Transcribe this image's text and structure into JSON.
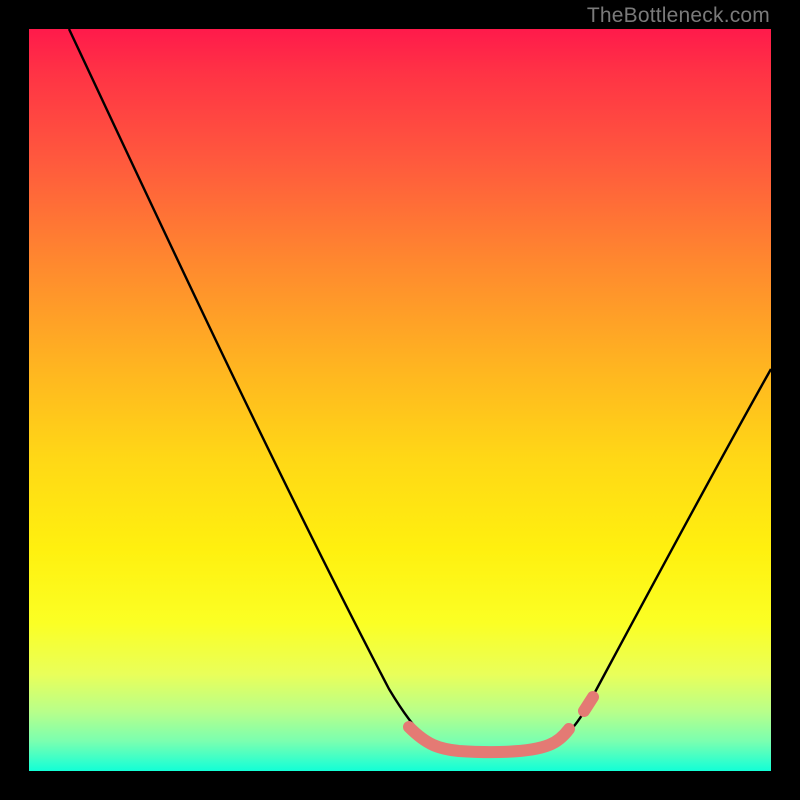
{
  "watermark": {
    "text": "TheBottleneck.com"
  },
  "chart_data": {
    "type": "line",
    "title": "",
    "xlabel": "",
    "ylabel": "",
    "xlim": [
      0,
      100
    ],
    "ylim": [
      0,
      100
    ],
    "grid": false,
    "legend_position": "none",
    "note": "V-shaped bottleneck curve over a red→yellow→green vertical gradient. X is normalized horizontal position (0–100) and Y is normalized 'bottleneck' value (0 near bottom/green = good, 100 at top/red = bad). Values estimated from pixel positions.",
    "series": [
      {
        "name": "bottleneck-curve",
        "x": [
          0,
          5,
          10,
          15,
          20,
          25,
          30,
          35,
          40,
          45,
          50,
          52,
          55,
          58,
          60,
          63,
          65,
          68,
          70,
          72,
          75,
          78,
          80,
          85,
          90,
          95,
          100
        ],
        "y": [
          98,
          90,
          82,
          74,
          66,
          58,
          50,
          42,
          34,
          25,
          15,
          10,
          6,
          4,
          3,
          3,
          3,
          3.5,
          4,
          5,
          8,
          13,
          18,
          27,
          36,
          45,
          54
        ]
      },
      {
        "name": "highlighted-segments",
        "segments": [
          {
            "x_start": 52,
            "x_end": 70,
            "description": "flat bottom highlighted in salmon"
          },
          {
            "x_start": 72,
            "x_end": 74,
            "description": "small salmon dot on rising edge"
          }
        ]
      }
    ],
    "colors": {
      "curve": "#000000",
      "highlight": "#e47a74",
      "gradient_top": "#ff1a4b",
      "gradient_mid": "#fff00f",
      "gradient_bottom": "#12ffd6"
    }
  }
}
